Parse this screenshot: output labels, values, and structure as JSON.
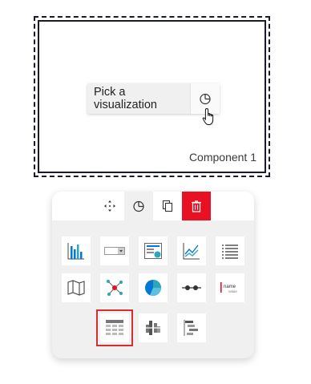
{
  "canvas": {
    "component_label": "Component 1",
    "pick_visualization": {
      "label": "Pick a visualization",
      "icon": "pie-chart-icon"
    }
  },
  "panel": {
    "toolbar": [
      {
        "id": "move",
        "icon": "move-arrows-icon",
        "active": false
      },
      {
        "id": "visualization",
        "icon": "pie-chart-icon",
        "active": true
      },
      {
        "id": "duplicate",
        "icon": "copy-icon",
        "active": false
      },
      {
        "id": "delete",
        "icon": "trash-icon",
        "active": false,
        "color": "#e81123"
      }
    ],
    "visualizations": [
      {
        "icon": "column-chart-icon"
      },
      {
        "icon": "dropdown-icon"
      },
      {
        "icon": "card-icon"
      },
      {
        "icon": "line-chart-icon"
      },
      {
        "icon": "list-icon"
      },
      {
        "icon": "map-icon"
      },
      {
        "icon": "network-graph-icon"
      },
      {
        "icon": "pie-chart-icon"
      },
      {
        "icon": "slider-icon"
      },
      {
        "icon": "text-label-icon",
        "label_name": "name",
        "label_value": "value"
      },
      {
        "icon": "table-icon",
        "selected": true
      },
      {
        "icon": "bullet-chart-icon"
      },
      {
        "icon": "gantt-icon"
      }
    ]
  },
  "colors": {
    "accent": "#0078d4",
    "delete": "#e81123",
    "selection": "#d32f2f",
    "teal": "#2aa7b8"
  }
}
